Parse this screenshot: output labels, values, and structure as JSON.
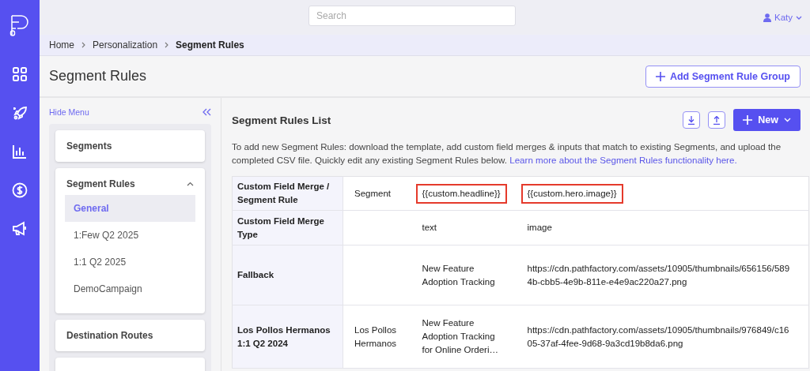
{
  "rail": {
    "icons": [
      {
        "kind": "logo"
      },
      {
        "kind": "grid"
      },
      {
        "kind": "rocket"
      },
      {
        "kind": "chart"
      },
      {
        "kind": "dollar"
      },
      {
        "kind": "megaphone"
      }
    ]
  },
  "topbar": {
    "search": {
      "placeholder": "Search"
    },
    "user": {
      "name": "Katy"
    }
  },
  "breadcrumb": [
    {
      "label": "Home",
      "current": false
    },
    {
      "label": "Personalization",
      "current": false
    },
    {
      "label": "Segment Rules",
      "current": true
    }
  ],
  "page": {
    "title": "Segment Rules",
    "add_button": "Add Segment Rule Group"
  },
  "sidebar": {
    "hide_label": "Hide Menu",
    "sections": [
      {
        "label": "Segments",
        "expanded": false
      },
      {
        "label": "Segment Rules",
        "expanded": true,
        "children": [
          {
            "label": "General",
            "selected": true
          },
          {
            "label": "1:Few Q2 2025",
            "selected": false
          },
          {
            "label": "1:1 Q2 2025",
            "selected": false
          },
          {
            "label": "DemoCampaign",
            "selected": false
          }
        ]
      },
      {
        "label": "Destination Routes",
        "expanded": false
      }
    ]
  },
  "list": {
    "title": "Segment Rules List",
    "new_button": "New",
    "description": "To add new Segment Rules: download the template, add custom field merges & inputs that match to existing Segments, and upload the completed CSV file. Quickly edit any existing Segment Rules below. ",
    "link": "Learn more about the Segment Rules functionality here.",
    "table": {
      "rows": [
        {
          "header": "Custom Field Merge / Segment Rule",
          "cells": [
            {
              "text": "Segment",
              "highlighted": false
            },
            {
              "text": "{{custom.headline}}",
              "highlighted": true
            },
            {
              "text": "{{custom.hero.image}}",
              "highlighted": true
            }
          ]
        },
        {
          "header": "Custom Field Merge Type",
          "cells": [
            {
              "text": "",
              "highlighted": false
            },
            {
              "text": "text",
              "highlighted": false
            },
            {
              "text": "image",
              "highlighted": false
            }
          ]
        },
        {
          "header": "Fallback",
          "cells": [
            {
              "text": "",
              "highlighted": false
            },
            {
              "text": "New Feature\nAdoption Tracking",
              "highlighted": false
            },
            {
              "text": "https://cdn.pathfactory.com/assets/10905/thumbnails/656156/589\n4b-cbb5-4e9b-811e-e4e9ac220a27.png",
              "highlighted": false
            }
          ]
        },
        {
          "header": "Los Pollos Hermanos 1:1 Q2 2024",
          "cells": [
            {
              "text": "Los Pollos\nHermanos",
              "highlighted": false
            },
            {
              "text": "New Feature\nAdoption Tracking\nfor Online Orderi…",
              "highlighted": false
            },
            {
              "text": "https://cdn.pathfactory.com/assets/10905/thumbnails/976849/c16\n05-37af-4fee-9d68-9a3cd19b8da6.png",
              "highlighted": false
            }
          ]
        }
      ]
    }
  }
}
